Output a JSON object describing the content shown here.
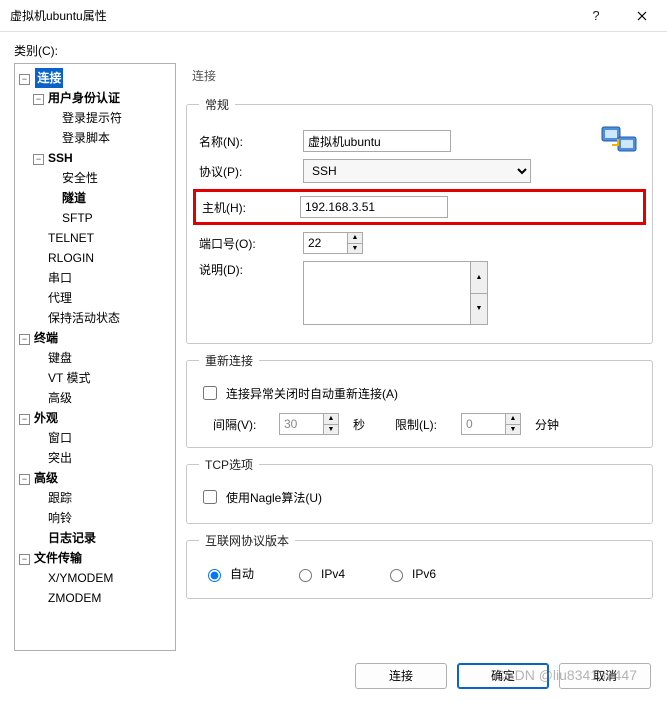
{
  "window": {
    "title": "虚拟机ubuntu属性"
  },
  "category_label": "类别(C):",
  "tree": {
    "root": "连接",
    "auth": "用户身份认证",
    "auth_prompt": "登录提示符",
    "auth_script": "登录脚本",
    "ssh": "SSH",
    "ssh_sec": "安全性",
    "ssh_tunnel": "隧道",
    "ssh_sftp": "SFTP",
    "telnet": "TELNET",
    "rlogin": "RLOGIN",
    "serial": "串口",
    "proxy": "代理",
    "keepalive": "保持活动状态",
    "terminal": "终端",
    "kb": "键盘",
    "vt": "VT 模式",
    "adv": "高级",
    "appearance": "外观",
    "win": "窗口",
    "hl": "突出",
    "advanced": "高级",
    "trace": "跟踪",
    "bell": "响铃",
    "log": "日志记录",
    "filetx": "文件传输",
    "xy": "X/YMODEM",
    "z": "ZMODEM"
  },
  "panel": {
    "title": "连接",
    "general": {
      "legend": "常规",
      "name_label": "名称(N):",
      "name_value": "虚拟机ubuntu",
      "proto_label": "协议(P):",
      "proto_value": "SSH",
      "host_label": "主机(H):",
      "host_value": "192.168.3.51",
      "port_label": "端口号(O):",
      "port_value": "22",
      "desc_label": "说明(D):",
      "desc_value": ""
    },
    "reconnect": {
      "legend": "重新连接",
      "auto_label": "连接异常关闭时自动重新连接(A)",
      "interval_label": "间隔(V):",
      "interval_value": "30",
      "interval_unit": "秒",
      "limit_label": "限制(L):",
      "limit_value": "0",
      "limit_unit": "分钟"
    },
    "tcp": {
      "legend": "TCP选项",
      "nagle_label": "使用Nagle算法(U)"
    },
    "ipver": {
      "legend": "互联网协议版本",
      "auto": "自动",
      "v4": "IPv4",
      "v6": "IPv6"
    }
  },
  "buttons": {
    "connect": "连接",
    "ok": "确定",
    "cancel": "取消"
  },
  "watermark": "CSDN @liu834139447"
}
